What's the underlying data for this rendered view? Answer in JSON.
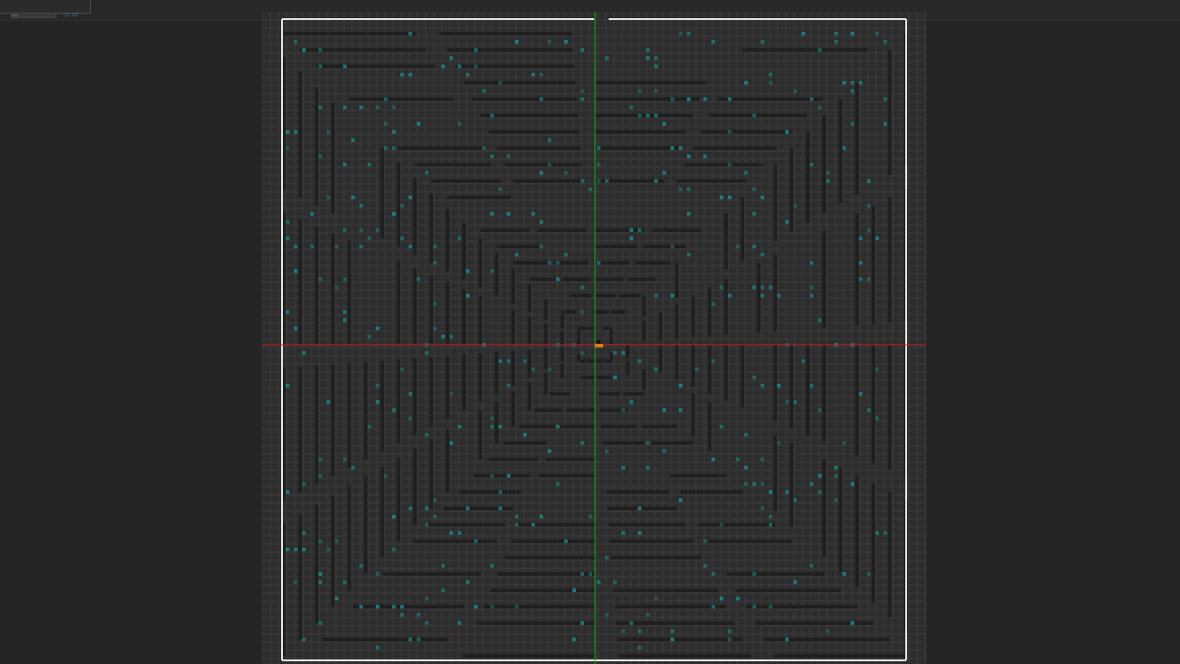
{
  "app": {
    "panel_tab_label": "Grid",
    "panel_link_label": "□□ □□"
  },
  "level_editor": {
    "grid": "on",
    "axis_x_color": "#cc2020",
    "axis_y_color": "#10b010",
    "bounds_color": "#e6e6e6",
    "tile_color": "#1f7f7f",
    "wall_color": "#1b1b1b",
    "background_color": "#2d2d2d",
    "player_marker_color": "#e8741c"
  }
}
